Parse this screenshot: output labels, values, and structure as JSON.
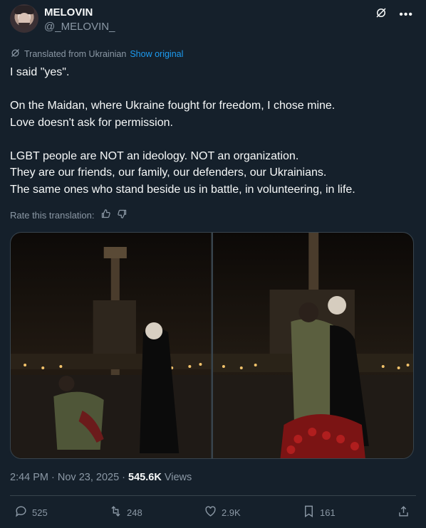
{
  "author": {
    "name": "MELOVIN",
    "handle": "@_MELOVIN_"
  },
  "translation": {
    "note": "Translated from Ukrainian",
    "show_original": "Show original",
    "rate_label": "Rate this translation:"
  },
  "post": {
    "paragraphs": [
      "I said \"yes\".",
      "On the Maidan, where Ukraine fought for freedom, I chose mine.\nLove doesn't ask for permission.",
      "LGBT people are NOT an ideology. NOT an organization.\nThey are our friends, our family, our defenders, our Ukrainians.\nThe same ones who stand beside us in battle, in volunteering, in life."
    ]
  },
  "meta": {
    "time": "2:44 PM",
    "sep1": " · ",
    "date": "Nov 23, 2025",
    "sep2": " · ",
    "views_count": "545.6K",
    "views_label": " Views"
  },
  "actions": {
    "replies": "525",
    "reposts": "248",
    "likes": "2.9K",
    "bookmarks": "161"
  },
  "icons": [
    "grok-icon",
    "more-icon",
    "translate-icon",
    "thumbs-up-icon",
    "thumbs-down-icon",
    "reply-icon",
    "repost-icon",
    "like-icon",
    "bookmark-icon",
    "share-icon"
  ],
  "colors": {
    "background": "#15202b",
    "text": "#f7f9f9",
    "muted": "#8b98a5",
    "link": "#1d9bf0",
    "border": "#38444d"
  }
}
